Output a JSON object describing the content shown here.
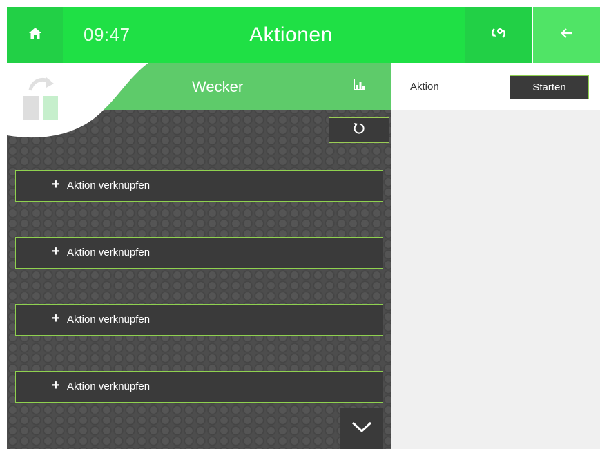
{
  "header": {
    "time": "09:47",
    "title": "Aktionen",
    "home_icon": "home-icon",
    "settings_icon": "gear-icon",
    "back_icon": "arrow-left-icon"
  },
  "panel": {
    "title": "Wecker",
    "chart_icon": "bar-chart-icon",
    "reload_icon": "reload-icon",
    "logo_icon": "dashboard-switch-logo",
    "actions": [
      {
        "plus": "+",
        "label": "Aktion verknüpfen"
      },
      {
        "plus": "+",
        "label": "Aktion verknüpfen"
      },
      {
        "plus": "+",
        "label": "Aktion verknüpfen"
      },
      {
        "plus": "+",
        "label": "Aktion verknüpfen"
      }
    ],
    "scroll_icon": "chevron-down-icon"
  },
  "right": {
    "caption": "Aktion",
    "start_label": "Starten"
  },
  "colors": {
    "accent": "#1fe045",
    "accent_dark": "#22d046",
    "panel_green": "#5ecb6a",
    "border_green": "#8fd14f",
    "dark_button": "#3a3a3a"
  }
}
